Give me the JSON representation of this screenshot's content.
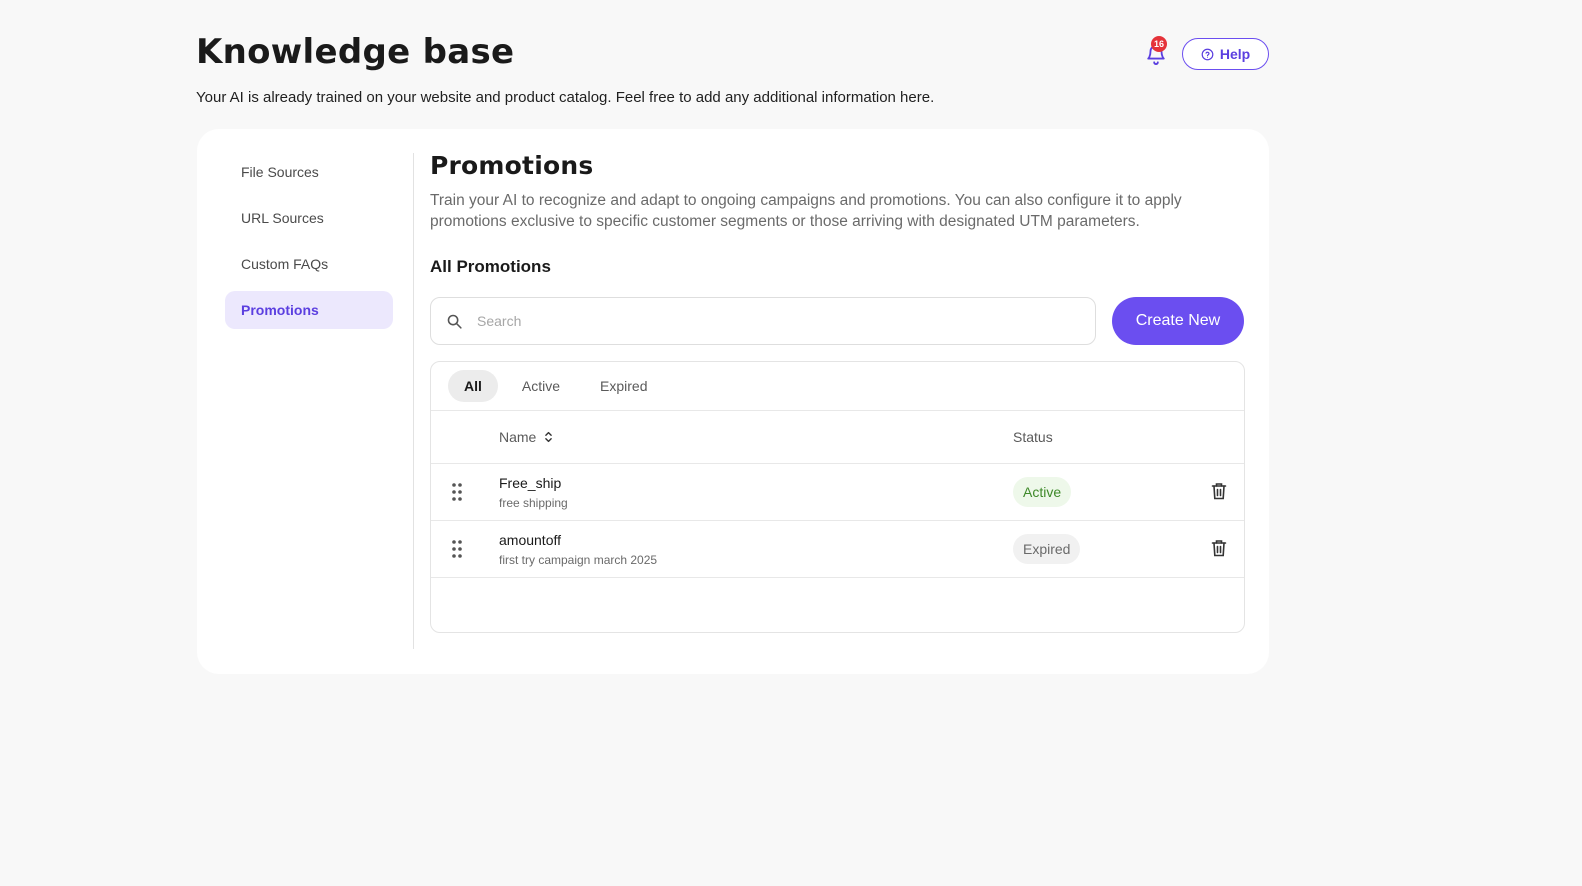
{
  "header": {
    "title": "Knowledge base",
    "subtitle": "Your AI is already trained on your website and product catalog. Feel free to add any additional information here.",
    "notification_count": "16",
    "help_label": "Help"
  },
  "sidebar": {
    "items": [
      {
        "label": "File Sources"
      },
      {
        "label": "URL Sources"
      },
      {
        "label": "Custom FAQs"
      },
      {
        "label": "Promotions",
        "active": true
      }
    ]
  },
  "main": {
    "title": "Promotions",
    "description": "Train your AI to recognize and adapt to ongoing campaigns and promotions. You can also configure it to apply promotions exclusive to specific customer segments or those arriving with designated UTM parameters.",
    "section_title": "All Promotions",
    "search": {
      "placeholder": "Search",
      "value": ""
    },
    "create_label": "Create New",
    "filters": [
      {
        "label": "All",
        "active": true
      },
      {
        "label": "Active"
      },
      {
        "label": "Expired"
      }
    ],
    "table": {
      "columns": {
        "name": "Name",
        "status": "Status"
      },
      "rows": [
        {
          "name": "Free_ship",
          "description": "free shipping",
          "status": "Active"
        },
        {
          "name": "amountoff",
          "description": "first try campaign march 2025",
          "status": "Expired"
        }
      ]
    }
  },
  "colors": {
    "accent": "#6b4ef0",
    "active_badge_bg": "#eef8ea",
    "active_badge_text": "#3f8a2a",
    "badge_red": "#e5333a"
  }
}
